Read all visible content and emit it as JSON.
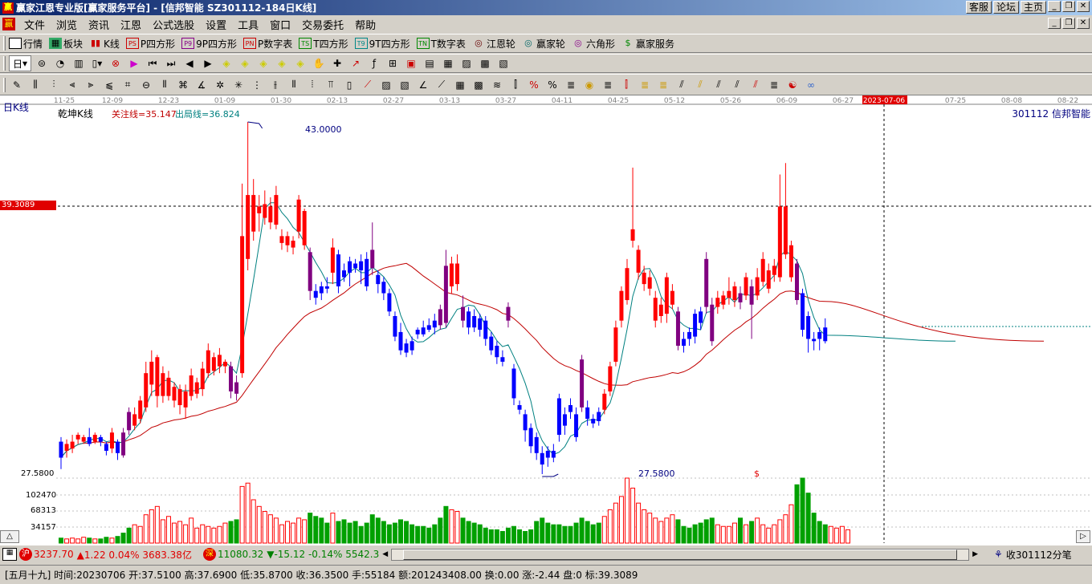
{
  "window": {
    "title": "赢家江恩专业版[赢家服务平台] - [信邦智能   SZ301112-184日K线]",
    "top_buttons": [
      "客服",
      "论坛",
      "主页"
    ]
  },
  "menu": [
    "文件",
    "浏览",
    "资讯",
    "江恩",
    "公式选股",
    "设置",
    "工具",
    "窗口",
    "交易委托",
    "帮助"
  ],
  "toolbar1": [
    "行情",
    "板块",
    "K线",
    "P四方形",
    "9P四方形",
    "P数字表",
    "T四方形",
    "9T四方形",
    "T数字表",
    "江恩轮",
    "赢家轮",
    "六角形",
    "赢家服务"
  ],
  "toolbar2": {
    "period": "日"
  },
  "chart": {
    "period_label": "日K线",
    "indicator_name": "乾坤K线",
    "indicator_line1": "关注线=35.147",
    "indicator_line2": "出局线=36.824",
    "stock_label": "301112 信邦智能",
    "date_ticks": [
      "11-25",
      "12-09",
      "12-23",
      "01-09",
      "01-30",
      "02-13",
      "02-27",
      "03-13",
      "03-27",
      "04-11",
      "04-25",
      "05-12",
      "05-26",
      "06-09",
      "06-27",
      "2023-07-06",
      "07-25",
      "08-08",
      "08-22"
    ],
    "cursor_date": "2023-07-06",
    "cursor_price": "39.3089",
    "high_label": "43.0000",
    "low_label": "27.5800",
    "low_axis_label": "27.5800",
    "volume_ticks": [
      "102470",
      "68313",
      "34157"
    ],
    "dollar_mark": "$",
    "colors": {
      "up": "#ff0000",
      "down": "#0000ff",
      "purple": "#800080",
      "ma_red": "#c00000",
      "ma_teal": "#008080",
      "vol_up": "#ff0000",
      "vol_down": "#00a000"
    }
  },
  "chart_data": {
    "type": "candlestick",
    "y_range": [
      27.58,
      43.0
    ],
    "candles": [
      {
        "o": 29.0,
        "c": 28.3,
        "h": 29.2,
        "l": 27.8,
        "t": "d"
      },
      {
        "o": 28.6,
        "c": 28.9,
        "h": 29.1,
        "l": 28.3,
        "t": "u"
      },
      {
        "o": 28.7,
        "c": 29.0,
        "h": 29.3,
        "l": 28.5,
        "t": "u"
      },
      {
        "o": 29.1,
        "c": 29.3,
        "h": 29.4,
        "l": 28.9,
        "t": "u"
      },
      {
        "o": 29.0,
        "c": 29.2,
        "h": 29.3,
        "l": 28.9,
        "t": "u"
      },
      {
        "o": 29.2,
        "c": 28.9,
        "h": 29.6,
        "l": 28.8,
        "t": "d"
      },
      {
        "o": 29.0,
        "c": 29.3,
        "h": 29.4,
        "l": 28.9,
        "t": "u"
      },
      {
        "o": 29.2,
        "c": 29.0,
        "h": 29.3,
        "l": 28.8,
        "t": "d"
      },
      {
        "o": 28.9,
        "c": 28.6,
        "h": 29.0,
        "l": 28.4,
        "t": "d"
      },
      {
        "o": 28.7,
        "c": 29.4,
        "h": 29.6,
        "l": 28.5,
        "t": "u"
      },
      {
        "o": 29.0,
        "c": 28.5,
        "h": 29.1,
        "l": 28.2,
        "t": "d"
      },
      {
        "o": 28.4,
        "c": 29.4,
        "h": 29.6,
        "l": 28.3,
        "t": "p"
      },
      {
        "o": 29.5,
        "c": 30.3,
        "h": 30.5,
        "l": 29.3,
        "t": "p"
      },
      {
        "o": 29.7,
        "c": 30.2,
        "h": 30.5,
        "l": 29.5,
        "t": "u"
      },
      {
        "o": 30.0,
        "c": 30.8,
        "h": 31.0,
        "l": 29.8,
        "t": "u"
      },
      {
        "o": 30.5,
        "c": 32.0,
        "h": 32.5,
        "l": 30.3,
        "t": "u"
      },
      {
        "o": 31.5,
        "c": 32.5,
        "h": 33.0,
        "l": 31.0,
        "t": "u"
      },
      {
        "o": 32.7,
        "c": 31.0,
        "h": 32.8,
        "l": 30.5,
        "t": "u"
      },
      {
        "o": 31.0,
        "c": 32.0,
        "h": 32.3,
        "l": 30.7,
        "t": "u"
      },
      {
        "o": 31.8,
        "c": 31.0,
        "h": 32.1,
        "l": 30.8,
        "t": "u"
      },
      {
        "o": 30.8,
        "c": 31.4,
        "h": 31.6,
        "l": 30.5,
        "t": "u"
      },
      {
        "o": 31.3,
        "c": 30.6,
        "h": 31.5,
        "l": 30.2,
        "t": "u"
      },
      {
        "o": 30.5,
        "c": 31.2,
        "h": 31.5,
        "l": 30.0,
        "t": "u"
      },
      {
        "o": 31.0,
        "c": 31.9,
        "h": 32.2,
        "l": 30.8,
        "t": "u"
      },
      {
        "o": 31.6,
        "c": 31.1,
        "h": 31.8,
        "l": 30.9,
        "t": "u"
      },
      {
        "o": 31.3,
        "c": 32.2,
        "h": 32.5,
        "l": 31.0,
        "t": "u"
      },
      {
        "o": 32.0,
        "c": 33.0,
        "h": 33.3,
        "l": 31.8,
        "t": "u"
      },
      {
        "o": 32.7,
        "c": 32.1,
        "h": 32.9,
        "l": 31.9,
        "t": "u"
      },
      {
        "o": 32.3,
        "c": 32.8,
        "h": 33.1,
        "l": 32.0,
        "t": "u"
      },
      {
        "o": 32.5,
        "c": 32.3,
        "h": 32.6,
        "l": 32.0,
        "t": "u"
      },
      {
        "o": 32.3,
        "c": 31.2,
        "h": 32.5,
        "l": 30.9,
        "t": "p"
      },
      {
        "o": 31.1,
        "c": 31.6,
        "h": 31.9,
        "l": 30.8,
        "t": "p"
      },
      {
        "o": 32.0,
        "c": 38.0,
        "h": 40.3,
        "l": 31.8,
        "t": "u"
      },
      {
        "o": 37.0,
        "c": 39.8,
        "h": 43.0,
        "l": 36.5,
        "t": "u"
      },
      {
        "o": 38.2,
        "c": 39.8,
        "h": 40.5,
        "l": 37.8,
        "t": "u"
      },
      {
        "o": 39.3,
        "c": 39.0,
        "h": 39.8,
        "l": 38.2,
        "t": "u"
      },
      {
        "o": 38.8,
        "c": 39.4,
        "h": 40.0,
        "l": 38.5,
        "t": "u"
      },
      {
        "o": 38.6,
        "c": 39.3,
        "h": 39.7,
        "l": 38.3,
        "t": "u"
      },
      {
        "o": 38.5,
        "c": 39.8,
        "h": 40.2,
        "l": 38.3,
        "t": "u"
      },
      {
        "o": 38.0,
        "c": 37.7,
        "h": 38.3,
        "l": 37.4,
        "t": "u"
      },
      {
        "o": 38.0,
        "c": 37.6,
        "h": 38.2,
        "l": 37.3,
        "t": "u"
      },
      {
        "o": 37.8,
        "c": 37.5,
        "h": 38.0,
        "l": 37.2,
        "t": "u"
      },
      {
        "o": 39.6,
        "c": 38.2,
        "h": 39.8,
        "l": 37.9,
        "t": "u"
      },
      {
        "o": 39.1,
        "c": 37.6,
        "h": 39.2,
        "l": 37.4,
        "t": "u"
      },
      {
        "o": 37.3,
        "c": 35.6,
        "h": 37.5,
        "l": 35.2,
        "t": "p"
      },
      {
        "o": 35.6,
        "c": 35.3,
        "h": 35.9,
        "l": 35.0,
        "t": "d"
      },
      {
        "o": 35.8,
        "c": 35.5,
        "h": 36.0,
        "l": 35.2,
        "t": "d"
      },
      {
        "o": 35.7,
        "c": 35.8,
        "h": 36.2,
        "l": 35.5,
        "t": "d"
      },
      {
        "o": 36.4,
        "c": 37.5,
        "h": 37.9,
        "l": 35.9,
        "t": "u"
      },
      {
        "o": 37.2,
        "c": 35.8,
        "h": 37.4,
        "l": 35.5,
        "t": "d"
      },
      {
        "o": 36.5,
        "c": 36.2,
        "h": 36.8,
        "l": 36.0,
        "t": "d"
      },
      {
        "o": 36.4,
        "c": 36.9,
        "h": 37.1,
        "l": 35.8,
        "t": "d"
      },
      {
        "o": 36.8,
        "c": 36.6,
        "h": 37.0,
        "l": 36.4,
        "t": "d"
      },
      {
        "o": 36.9,
        "c": 36.5,
        "h": 37.2,
        "l": 35.9,
        "t": "d"
      },
      {
        "o": 37.0,
        "c": 35.8,
        "h": 37.3,
        "l": 35.6,
        "t": "d"
      },
      {
        "o": 36.6,
        "c": 37.4,
        "h": 38.6,
        "l": 36.3,
        "t": "p"
      },
      {
        "o": 36.3,
        "c": 35.9,
        "h": 36.5,
        "l": 35.5,
        "t": "d"
      },
      {
        "o": 36.0,
        "c": 35.5,
        "h": 36.2,
        "l": 35.2,
        "t": "d"
      },
      {
        "o": 35.5,
        "c": 34.7,
        "h": 35.7,
        "l": 34.5,
        "t": "d"
      },
      {
        "o": 34.5,
        "c": 33.6,
        "h": 34.7,
        "l": 33.4,
        "t": "d"
      },
      {
        "o": 33.8,
        "c": 33.0,
        "h": 34.2,
        "l": 32.8,
        "t": "d"
      },
      {
        "o": 33.3,
        "c": 32.9,
        "h": 33.5,
        "l": 32.7,
        "t": "d"
      },
      {
        "o": 33.0,
        "c": 33.4,
        "h": 33.6,
        "l": 32.8,
        "t": "d"
      },
      {
        "o": 33.7,
        "c": 33.9,
        "h": 34.0,
        "l": 33.5,
        "t": "d"
      },
      {
        "o": 34.0,
        "c": 33.7,
        "h": 34.3,
        "l": 33.6,
        "t": "d"
      },
      {
        "o": 34.1,
        "c": 33.9,
        "h": 34.4,
        "l": 33.8,
        "t": "d"
      },
      {
        "o": 34.3,
        "c": 34.0,
        "h": 34.6,
        "l": 33.7,
        "t": "d"
      },
      {
        "o": 34.8,
        "c": 34.1,
        "h": 35.0,
        "l": 33.9,
        "t": "p"
      },
      {
        "o": 36.7,
        "c": 34.2,
        "h": 37.4,
        "l": 34.0,
        "t": "p"
      },
      {
        "o": 36.8,
        "c": 35.8,
        "h": 37.1,
        "l": 35.5,
        "t": "u"
      },
      {
        "o": 36.8,
        "c": 35.9,
        "h": 37.2,
        "l": 35.6,
        "t": "u"
      },
      {
        "o": 34.9,
        "c": 34.3,
        "h": 35.4,
        "l": 34.0,
        "t": "p"
      },
      {
        "o": 34.0,
        "c": 34.7,
        "h": 34.9,
        "l": 33.7,
        "t": "d"
      },
      {
        "o": 34.5,
        "c": 34.0,
        "h": 34.8,
        "l": 33.8,
        "t": "d"
      },
      {
        "o": 34.4,
        "c": 33.9,
        "h": 34.6,
        "l": 33.6,
        "t": "d"
      },
      {
        "o": 34.3,
        "c": 33.5,
        "h": 34.5,
        "l": 33.2,
        "t": "d"
      },
      {
        "o": 33.6,
        "c": 33.0,
        "h": 33.8,
        "l": 32.8,
        "t": "d"
      },
      {
        "o": 33.2,
        "c": 32.7,
        "h": 33.4,
        "l": 32.4,
        "t": "d"
      },
      {
        "o": 32.5,
        "c": 32.7,
        "h": 33.0,
        "l": 32.3,
        "t": "d"
      },
      {
        "o": 34.9,
        "c": 34.3,
        "h": 35.1,
        "l": 34.0,
        "t": "p"
      },
      {
        "o": 32.2,
        "c": 30.9,
        "h": 32.4,
        "l": 30.6,
        "t": "d"
      },
      {
        "o": 30.6,
        "c": 30.4,
        "h": 30.8,
        "l": 30.2,
        "t": "d"
      },
      {
        "o": 30.2,
        "c": 29.5,
        "h": 30.4,
        "l": 29.0,
        "t": "d"
      },
      {
        "o": 29.6,
        "c": 28.8,
        "h": 29.8,
        "l": 28.5,
        "t": "d"
      },
      {
        "o": 29.2,
        "c": 28.5,
        "h": 29.4,
        "l": 28.2,
        "t": "d"
      },
      {
        "o": 28.5,
        "c": 28.0,
        "h": 28.8,
        "l": 27.58,
        "t": "d"
      },
      {
        "o": 28.3,
        "c": 28.6,
        "h": 28.8,
        "l": 27.9,
        "t": "d"
      },
      {
        "o": 28.6,
        "c": 28.3,
        "h": 28.9,
        "l": 28.1,
        "t": "d"
      },
      {
        "o": 30.9,
        "c": 29.3,
        "h": 31.1,
        "l": 29.0,
        "t": "d"
      },
      {
        "o": 30.2,
        "c": 29.7,
        "h": 30.5,
        "l": 29.3,
        "t": "d"
      },
      {
        "o": 30.6,
        "c": 30.3,
        "h": 30.9,
        "l": 30.0,
        "t": "d"
      },
      {
        "o": 30.2,
        "c": 29.2,
        "h": 30.5,
        "l": 29.0,
        "t": "d"
      },
      {
        "o": 32.6,
        "c": 30.5,
        "h": 32.8,
        "l": 30.3,
        "t": "p"
      },
      {
        "o": 30.5,
        "c": 30.0,
        "h": 30.8,
        "l": 29.7,
        "t": "d"
      },
      {
        "o": 30.0,
        "c": 29.8,
        "h": 30.2,
        "l": 29.6,
        "t": "d"
      },
      {
        "o": 29.9,
        "c": 30.3,
        "h": 30.5,
        "l": 29.7,
        "t": "d"
      },
      {
        "o": 30.4,
        "c": 31.1,
        "h": 31.3,
        "l": 30.2,
        "t": "u"
      },
      {
        "o": 31.2,
        "c": 32.3,
        "h": 32.5,
        "l": 31.0,
        "t": "u"
      },
      {
        "o": 32.5,
        "c": 34.0,
        "h": 34.3,
        "l": 32.3,
        "t": "u"
      },
      {
        "o": 34.3,
        "c": 35.6,
        "h": 35.8,
        "l": 34.0,
        "t": "u"
      },
      {
        "o": 35.2,
        "c": 36.6,
        "h": 37.0,
        "l": 35.0,
        "t": "u"
      },
      {
        "o": 37.8,
        "c": 38.3,
        "h": 41.0,
        "l": 37.5,
        "t": "u"
      },
      {
        "o": 37.4,
        "c": 36.4,
        "h": 37.6,
        "l": 36.1,
        "t": "u"
      },
      {
        "o": 36.4,
        "c": 35.9,
        "h": 36.7,
        "l": 35.6,
        "t": "u"
      },
      {
        "o": 36.2,
        "c": 35.7,
        "h": 36.5,
        "l": 35.4,
        "t": "u"
      },
      {
        "o": 35.3,
        "c": 34.3,
        "h": 35.6,
        "l": 34.0,
        "t": "u"
      },
      {
        "o": 35.0,
        "c": 34.5,
        "h": 35.3,
        "l": 34.2,
        "t": "u"
      },
      {
        "o": 36.2,
        "c": 34.6,
        "h": 36.4,
        "l": 34.2,
        "t": "u"
      },
      {
        "o": 35.6,
        "c": 35.0,
        "h": 35.9,
        "l": 34.8,
        "t": "u"
      },
      {
        "o": 34.7,
        "c": 33.2,
        "h": 34.9,
        "l": 33.0,
        "t": "p"
      },
      {
        "o": 33.5,
        "c": 33.2,
        "h": 33.8,
        "l": 32.9,
        "t": "d"
      },
      {
        "o": 33.5,
        "c": 33.8,
        "h": 34.0,
        "l": 33.2,
        "t": "d"
      },
      {
        "o": 33.6,
        "c": 34.6,
        "h": 34.8,
        "l": 33.3,
        "t": "d"
      },
      {
        "o": 34.2,
        "c": 34.7,
        "h": 34.9,
        "l": 33.9,
        "t": "d"
      },
      {
        "o": 34.9,
        "c": 37.0,
        "h": 37.3,
        "l": 34.6,
        "t": "p"
      },
      {
        "o": 35.0,
        "c": 33.4,
        "h": 35.3,
        "l": 33.2,
        "t": "p"
      },
      {
        "o": 34.9,
        "c": 35.3,
        "h": 35.6,
        "l": 34.6,
        "t": "u"
      },
      {
        "o": 35.0,
        "c": 35.4,
        "h": 35.6,
        "l": 34.8,
        "t": "u"
      },
      {
        "o": 35.3,
        "c": 35.6,
        "h": 36.2,
        "l": 35.0,
        "t": "u"
      },
      {
        "o": 35.2,
        "c": 35.8,
        "h": 36.0,
        "l": 34.9,
        "t": "u"
      },
      {
        "o": 35.5,
        "c": 35.1,
        "h": 35.8,
        "l": 34.8,
        "t": "p"
      },
      {
        "o": 36.2,
        "c": 35.4,
        "h": 36.4,
        "l": 35.2,
        "t": "u"
      },
      {
        "o": 35.8,
        "c": 35.0,
        "h": 36.1,
        "l": 33.5,
        "t": "p"
      },
      {
        "o": 35.4,
        "c": 36.2,
        "h": 36.6,
        "l": 35.2,
        "t": "u"
      },
      {
        "o": 36.0,
        "c": 37.0,
        "h": 37.3,
        "l": 35.8,
        "t": "u"
      },
      {
        "o": 35.7,
        "c": 36.5,
        "h": 36.8,
        "l": 35.5,
        "t": "u"
      },
      {
        "o": 36.3,
        "c": 36.7,
        "h": 37.0,
        "l": 36.0,
        "t": "u"
      },
      {
        "o": 36.2,
        "c": 39.3,
        "h": 40.7,
        "l": 36.0,
        "t": "u"
      },
      {
        "o": 39.3,
        "c": 37.2,
        "h": 41.2,
        "l": 37.0,
        "t": "u"
      },
      {
        "o": 37.6,
        "c": 36.2,
        "h": 37.8,
        "l": 36.0,
        "t": "u"
      },
      {
        "o": 36.8,
        "c": 35.2,
        "h": 37.0,
        "l": 35.0,
        "t": "p"
      },
      {
        "o": 35.5,
        "c": 33.9,
        "h": 35.7,
        "l": 33.6,
        "t": "d"
      },
      {
        "o": 34.5,
        "c": 33.5,
        "h": 34.7,
        "l": 32.9,
        "t": "d"
      },
      {
        "o": 33.5,
        "c": 33.4,
        "h": 33.8,
        "l": 33.0,
        "t": "d"
      },
      {
        "o": 33.8,
        "c": 33.5,
        "h": 34.0,
        "l": 33.0,
        "t": "d"
      },
      {
        "o": 33.4,
        "c": 34.0,
        "h": 34.4,
        "l": 33.3,
        "t": "d"
      }
    ],
    "volumes": [
      6,
      5,
      6,
      5,
      7,
      6,
      5,
      5,
      7,
      6,
      8,
      12,
      18,
      22,
      20,
      34,
      40,
      44,
      28,
      32,
      24,
      26,
      22,
      30,
      18,
      22,
      20,
      18,
      20,
      24,
      26,
      28,
      68,
      72,
      52,
      44,
      38,
      34,
      30,
      22,
      26,
      24,
      30,
      28,
      36,
      32,
      30,
      24,
      36,
      26,
      28,
      24,
      26,
      20,
      24,
      34,
      30,
      26,
      22,
      24,
      28,
      26,
      22,
      20,
      20,
      18,
      22,
      30,
      44,
      40,
      38,
      30,
      26,
      24,
      22,
      18,
      16,
      16,
      14,
      18,
      20,
      16,
      14,
      16,
      26,
      30,
      24,
      22,
      22,
      20,
      20,
      24,
      30,
      26,
      22,
      24,
      32,
      40,
      48,
      56,
      78,
      66,
      48,
      40,
      36,
      30,
      26,
      30,
      34,
      28,
      20,
      18,
      22,
      24,
      28,
      30,
      22,
      20,
      20,
      24,
      30,
      22,
      26,
      30,
      22,
      18,
      22,
      28,
      34,
      46,
      70,
      78,
      60,
      36,
      26,
      22,
      20,
      18,
      20,
      16
    ],
    "volume_ticks": [
      34157,
      68313,
      102470
    ]
  },
  "status1": {
    "sh_label": "沪",
    "sh_index": "3237.70",
    "sh_change": "▲1.22 0.04% 3683.38亿",
    "sz_label": "深",
    "sz_index": "11080.32",
    "sz_change": "▼-15.12 -0.14% 5542.3",
    "right_text": "收301112分笔"
  },
  "status2": {
    "text": "[五月十九] 时间:20230706 开:37.5100 高:37.6900 低:35.8700 收:36.3500 手:55184 额:201243408.00 换:0.00 涨:-2.44 盘:0 标:39.3089"
  }
}
